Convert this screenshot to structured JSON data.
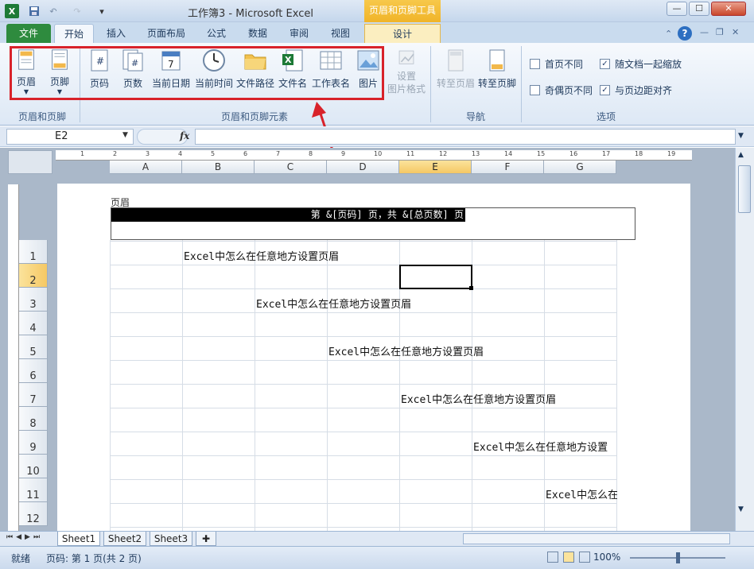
{
  "window": {
    "title": "工作簿3 - Microsoft Excel",
    "context_title": "页眉和页脚工具",
    "qat_undo": "↶",
    "qat_redo": "↷",
    "min": "—",
    "max": "☐",
    "close": "✕"
  },
  "tabs": [
    {
      "label": "文件"
    },
    {
      "label": "开始"
    },
    {
      "label": "插入"
    },
    {
      "label": "页面布局"
    },
    {
      "label": "公式"
    },
    {
      "label": "数据"
    },
    {
      "label": "审阅"
    },
    {
      "label": "视图"
    },
    {
      "label": "设计"
    }
  ],
  "ribbon": {
    "groups": {
      "hf": "页眉和页脚",
      "elements": "页眉和页脚元素",
      "nav": "导航",
      "options": "选项"
    },
    "buttons": {
      "header": "页眉",
      "footer": "页脚",
      "page_number": "页码",
      "page_count": "页数",
      "current_date": "当前日期",
      "current_time": "当前时间",
      "file_path": "文件路径",
      "file_name": "文件名",
      "sheet_name": "工作表名",
      "picture": "图片",
      "format_picture": "设置\n图片格式",
      "goto_header": "转至页眉",
      "goto_footer": "转至页脚"
    },
    "options": [
      {
        "label": "首页不同",
        "checked": false
      },
      {
        "label": "随文档一起缩放",
        "checked": true
      },
      {
        "label": "奇偶页不同",
        "checked": false
      },
      {
        "label": "与页边距对齐",
        "checked": true
      }
    ]
  },
  "formula_bar": {
    "name_box": "E2",
    "fx": "fx",
    "value": ""
  },
  "columns": [
    "A",
    "B",
    "C",
    "D",
    "E",
    "F",
    "G"
  ],
  "selected_column": "E",
  "rows": [
    "1",
    "2",
    "3",
    "4",
    "5",
    "6",
    "7",
    "8",
    "9",
    "10",
    "11",
    "12"
  ],
  "selected_row": "2",
  "header_area": {
    "label": "页眉",
    "field_text": "第 &[页码] 页，共 &[总页数] 页"
  },
  "cells": [
    {
      "row": "1",
      "col": "B",
      "text": "Excel中怎么在任意地方设置页眉"
    },
    {
      "row": "3",
      "col": "C",
      "text": "Excel中怎么在任意地方设置页眉"
    },
    {
      "row": "5",
      "col": "D",
      "text": "Excel中怎么在任意地方设置页眉"
    },
    {
      "row": "7",
      "col": "E",
      "text": "Excel中怎么在任意地方设置页眉"
    },
    {
      "row": "9",
      "col": "F",
      "text": "Excel中怎么在任意地方设置"
    },
    {
      "row": "11",
      "col": "G",
      "text": "Excel中怎么在"
    }
  ],
  "sheets": [
    "Sheet1",
    "Sheet2",
    "Sheet3"
  ],
  "active_sheet": "Sheet1",
  "status": {
    "ready": "就绪",
    "page": "页码: 第 1 页(共 2 页)",
    "zoom": "100%"
  },
  "colors": {
    "file_tab": "#2e8b3e",
    "context": "#f0b429",
    "highlight": "#d8222a",
    "selection": "#f5c864"
  }
}
